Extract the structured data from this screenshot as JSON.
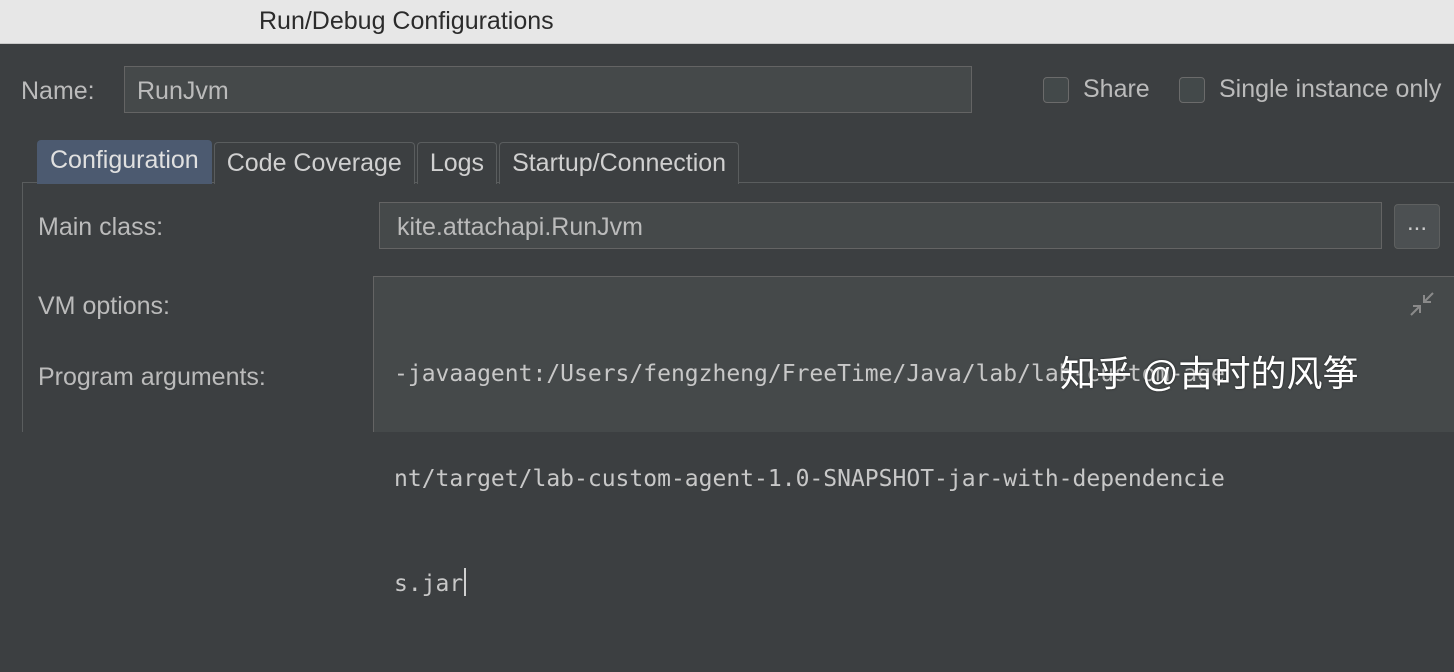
{
  "window": {
    "title": "Run/Debug Configurations"
  },
  "name_row": {
    "label": "Name:",
    "value": "RunJvm",
    "share_label": "Share",
    "single_instance_label": "Single instance only"
  },
  "tabs": [
    {
      "label": "Configuration",
      "active": true
    },
    {
      "label": "Code Coverage",
      "active": false
    },
    {
      "label": "Logs",
      "active": false
    },
    {
      "label": "Startup/Connection",
      "active": false
    }
  ],
  "main_class": {
    "label": "Main class:",
    "value": "kite.attachapi.RunJvm",
    "browse_label": "..."
  },
  "vm_options": {
    "label": "VM options:",
    "lines": [
      "-javaagent:/Users/fengzheng/FreeTime/Java/lab/lab-custom-age",
      "nt/target/lab-custom-agent-1.0-SNAPSHOT-jar-with-dependencie",
      "s.jar"
    ]
  },
  "program_arguments": {
    "label": "Program arguments:"
  },
  "watermark": {
    "text": "知乎 @古时的风筝"
  },
  "colors": {
    "background": "#3c3f41",
    "field": "#45494a",
    "active_tab": "#4c5a70",
    "titlebar": "#e7e7e7"
  }
}
